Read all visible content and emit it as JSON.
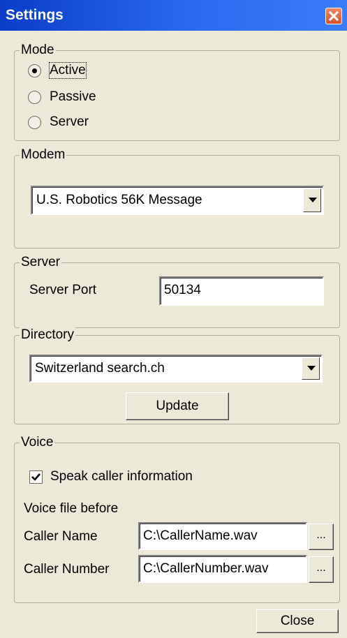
{
  "window": {
    "title": "Settings"
  },
  "mode": {
    "legend": "Mode",
    "options": [
      "Active",
      "Passive",
      "Server"
    ],
    "selected": "Active"
  },
  "modem": {
    "legend": "Modem",
    "selected": "U.S. Robotics 56K Message"
  },
  "server": {
    "legend": "Server",
    "port_label": "Server Port",
    "port_value": "50134"
  },
  "directory": {
    "legend": "Directory",
    "selected": "Switzerland search.ch",
    "update_label": "Update"
  },
  "voice": {
    "legend": "Voice",
    "speak_label": "Speak caller information",
    "speak_checked": true,
    "file_before_label": "Voice file before",
    "caller_name_label": "Caller Name",
    "caller_name_value": "C:\\CallerName.wav",
    "caller_number_label": "Caller Number",
    "caller_number_value": "C:\\CallerNumber.wav",
    "browse_label": "..."
  },
  "footer": {
    "close_label": "Close"
  },
  "icons": {
    "close": "close-icon",
    "dropdown": "chevron-down-icon",
    "check": "check-icon"
  },
  "colors": {
    "titlebar": "#0A3CC8",
    "dialog_bg": "#ECE9D8",
    "close_button": "#D8502C"
  }
}
